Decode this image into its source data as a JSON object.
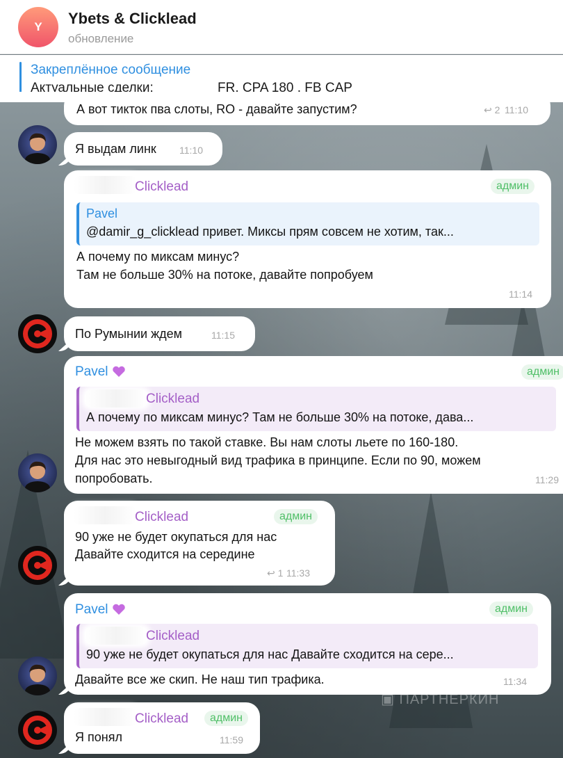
{
  "header": {
    "avatar_letter": "Y",
    "title": "Ybets & Clicklead",
    "subtitle": "обновление"
  },
  "pinned": {
    "title": "Закреплённое сообщение",
    "text_prefix": "Актуальные сделки:",
    "text_suffix": "FR, CPA 180 , FB CAP"
  },
  "messages": {
    "m0": {
      "text": "А вот тикток пва слоты, RO - давайте запустим?",
      "replies": "2",
      "time": "11:10"
    },
    "m1": {
      "text": "Я выдам линк",
      "time": "11:10"
    },
    "m2": {
      "sender": "Clicklead",
      "badge": "админ",
      "quote_author": "Pavel",
      "quote_text": "@damir_g_clicklead привет. Миксы прям совсем не хотим, так...",
      "line1": "А почему по миксам минус?",
      "line2": "Там не больше 30% на потоке, давайте попробуем",
      "time": "11:14"
    },
    "m3": {
      "text": "По Румынии ждем",
      "time": "11:15"
    },
    "m4": {
      "sender": "Pavel",
      "badge": "админ",
      "quote_author": "Clicklead",
      "quote_text": "А почему по миксам минус? Там не больше 30% на потоке, дава...",
      "line1": "Не можем взять по такой ставке. Вы нам слоты льете по 160-180.",
      "line2": "Для нас это невыгодный вид трафика в принципе. Если по 90, можем",
      "line3": "попробовать.",
      "time": "11:29"
    },
    "m5": {
      "sender": "Clicklead",
      "badge": "админ",
      "line1": "90 уже не будет окупаться для нас",
      "line2": "Давайте сходится на середине",
      "replies": "1",
      "time": "11:33"
    },
    "m6": {
      "sender": "Pavel",
      "badge": "админ",
      "quote_author": "Clicklead",
      "quote_text": "90 уже не будет окупаться для нас Давайте сходится на сере...",
      "line1": "Давайте все же скип. Не наш тип трафика.",
      "time": "11:34"
    },
    "m7": {
      "sender": "Clicklead",
      "badge": "админ",
      "text": "Я понял",
      "time": "11:59"
    }
  },
  "watermark": "ПАРТНЕРКИН",
  "colors": {
    "accent_blue": "#2f8fe0",
    "accent_purple": "#a45fc7",
    "admin_green": "#4fbf67"
  }
}
